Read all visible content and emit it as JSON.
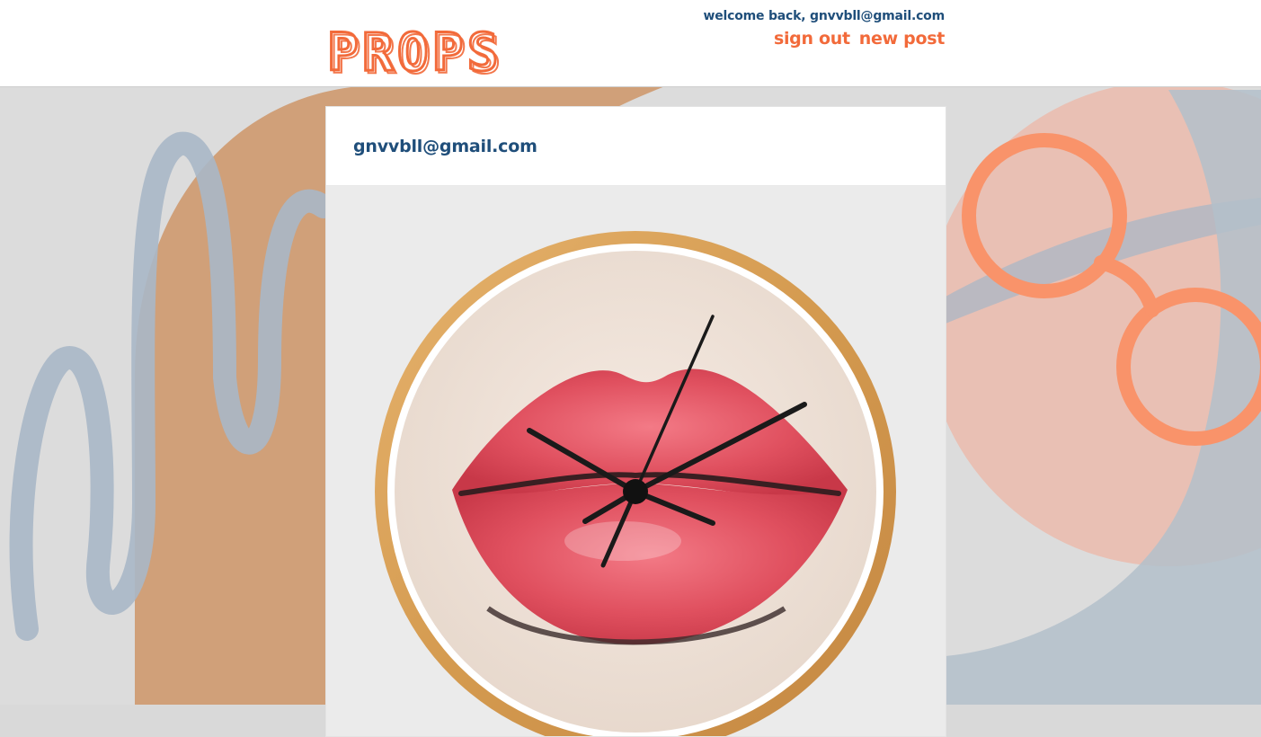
{
  "app": {
    "logo_text": "PROPS"
  },
  "header": {
    "welcome": "welcome back, gnvvbll@gmail.com",
    "links": {
      "sign_out": "sign out",
      "new_post": "new post"
    }
  },
  "post": {
    "author": "gnvvbll@gmail.com",
    "image_alt": "wall clock with red lips artwork"
  },
  "colors": {
    "accent": "#f26a3a",
    "brand_blue": "#1f4e7a",
    "muted_blue": "#a9b7c6",
    "peach": "#cf9c73",
    "pink": "#e9c0b4"
  }
}
